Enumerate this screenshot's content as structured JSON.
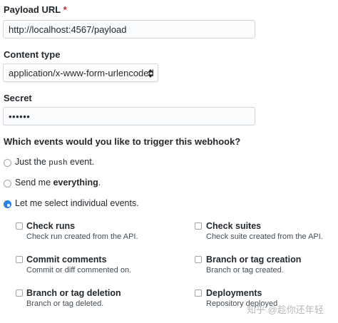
{
  "form": {
    "payload_url": {
      "label": "Payload URL",
      "required_mark": "*",
      "value": "http://localhost:4567/payload"
    },
    "content_type": {
      "label": "Content type",
      "selected": "application/x-www-form-urlencoded"
    },
    "secret": {
      "label": "Secret",
      "value": "••••••"
    }
  },
  "events": {
    "question": "Which events would you like to trigger this webhook?",
    "options": [
      {
        "pre": "Just the ",
        "code": "push",
        "post": " event.",
        "checked": false
      },
      {
        "pre": "Send me ",
        "bold": "everything",
        "post": ".",
        "checked": false
      },
      {
        "text": "Let me select individual events.",
        "checked": true
      }
    ],
    "individual": [
      {
        "title": "Check runs",
        "desc": "Check run created from the API.",
        "checked": false
      },
      {
        "title": "Check suites",
        "desc": "Check suite created from the API.",
        "checked": false
      },
      {
        "title": "Commit comments",
        "desc": "Commit or diff commented on.",
        "checked": false
      },
      {
        "title": "Branch or tag creation",
        "desc": "Branch or tag created.",
        "checked": false
      },
      {
        "title": "Branch or tag deletion",
        "desc": "Branch or tag deleted.",
        "checked": false
      },
      {
        "title": "Deployments",
        "desc": "Repository deployed",
        "checked": false
      }
    ]
  },
  "watermark": "知乎 @趁你还年轻",
  "colors": {
    "accent": "#2a82f2",
    "required": "#cb2431",
    "border": "#d1d5da"
  }
}
